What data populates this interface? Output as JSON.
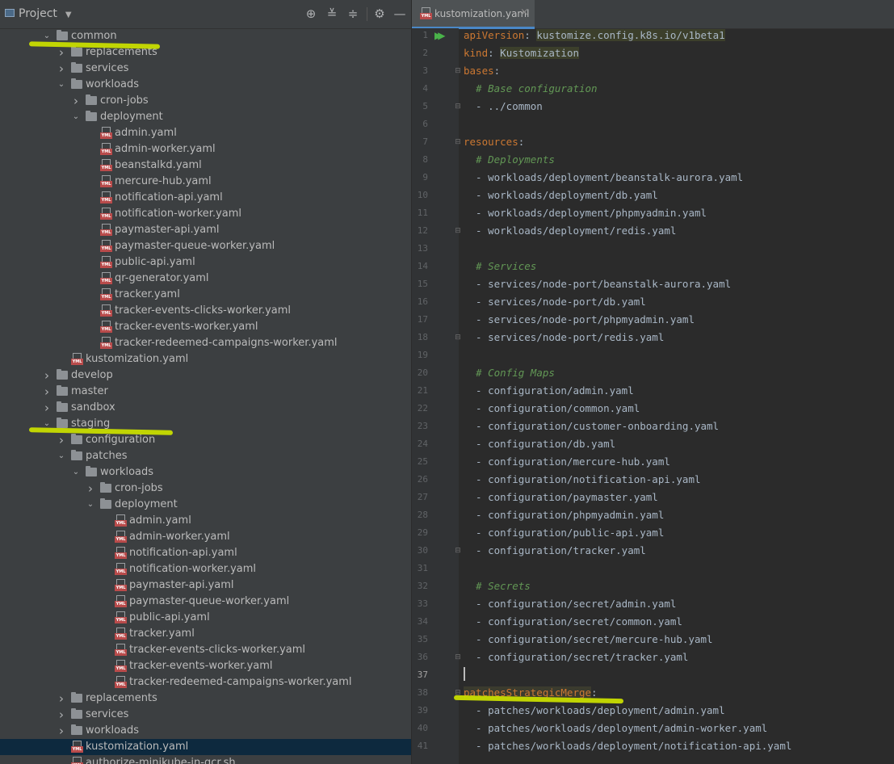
{
  "project_panel": {
    "title": "Project",
    "toolbar_icons": [
      "locate-icon",
      "expand-all-icon",
      "collapse-all-icon",
      "gear-icon",
      "minimize-icon"
    ],
    "tree": [
      {
        "label": "common",
        "type": "folder",
        "depth": 0,
        "expanded": true
      },
      {
        "label": "replacements",
        "type": "folder",
        "depth": 1,
        "expanded": false
      },
      {
        "label": "services",
        "type": "folder",
        "depth": 1,
        "expanded": false
      },
      {
        "label": "workloads",
        "type": "folder",
        "depth": 1,
        "expanded": true
      },
      {
        "label": "cron-jobs",
        "type": "folder",
        "depth": 2,
        "expanded": false
      },
      {
        "label": "deployment",
        "type": "folder",
        "depth": 2,
        "expanded": true
      },
      {
        "label": "admin.yaml",
        "type": "file",
        "depth": 3
      },
      {
        "label": "admin-worker.yaml",
        "type": "file",
        "depth": 3
      },
      {
        "label": "beanstalkd.yaml",
        "type": "file",
        "depth": 3
      },
      {
        "label": "mercure-hub.yaml",
        "type": "file",
        "depth": 3
      },
      {
        "label": "notification-api.yaml",
        "type": "file",
        "depth": 3
      },
      {
        "label": "notification-worker.yaml",
        "type": "file",
        "depth": 3
      },
      {
        "label": "paymaster-api.yaml",
        "type": "file",
        "depth": 3
      },
      {
        "label": "paymaster-queue-worker.yaml",
        "type": "file",
        "depth": 3
      },
      {
        "label": "public-api.yaml",
        "type": "file",
        "depth": 3
      },
      {
        "label": "qr-generator.yaml",
        "type": "file",
        "depth": 3
      },
      {
        "label": "tracker.yaml",
        "type": "file",
        "depth": 3
      },
      {
        "label": "tracker-events-clicks-worker.yaml",
        "type": "file",
        "depth": 3
      },
      {
        "label": "tracker-events-worker.yaml",
        "type": "file",
        "depth": 3
      },
      {
        "label": "tracker-redeemed-campaigns-worker.yaml",
        "type": "file",
        "depth": 3
      },
      {
        "label": "kustomization.yaml",
        "type": "file",
        "depth": 1
      },
      {
        "label": "develop",
        "type": "folder",
        "depth": 0,
        "expanded": false
      },
      {
        "label": "master",
        "type": "folder",
        "depth": 0,
        "expanded": false
      },
      {
        "label": "sandbox",
        "type": "folder",
        "depth": 0,
        "expanded": false
      },
      {
        "label": "staging",
        "type": "folder",
        "depth": 0,
        "expanded": true
      },
      {
        "label": "configuration",
        "type": "folder",
        "depth": 1,
        "expanded": false
      },
      {
        "label": "patches",
        "type": "folder",
        "depth": 1,
        "expanded": true
      },
      {
        "label": "workloads",
        "type": "folder",
        "depth": 2,
        "expanded": true
      },
      {
        "label": "cron-jobs",
        "type": "folder",
        "depth": 3,
        "expanded": false
      },
      {
        "label": "deployment",
        "type": "folder",
        "depth": 3,
        "expanded": true
      },
      {
        "label": "admin.yaml",
        "type": "file",
        "depth": 4
      },
      {
        "label": "admin-worker.yaml",
        "type": "file",
        "depth": 4
      },
      {
        "label": "notification-api.yaml",
        "type": "file",
        "depth": 4
      },
      {
        "label": "notification-worker.yaml",
        "type": "file",
        "depth": 4
      },
      {
        "label": "paymaster-api.yaml",
        "type": "file",
        "depth": 4
      },
      {
        "label": "paymaster-queue-worker.yaml",
        "type": "file",
        "depth": 4
      },
      {
        "label": "public-api.yaml",
        "type": "file",
        "depth": 4
      },
      {
        "label": "tracker.yaml",
        "type": "file",
        "depth": 4
      },
      {
        "label": "tracker-events-clicks-worker.yaml",
        "type": "file",
        "depth": 4
      },
      {
        "label": "tracker-events-worker.yaml",
        "type": "file",
        "depth": 4
      },
      {
        "label": "tracker-redeemed-campaigns-worker.yaml",
        "type": "file",
        "depth": 4
      },
      {
        "label": "replacements",
        "type": "folder",
        "depth": 1,
        "expanded": false
      },
      {
        "label": "services",
        "type": "folder",
        "depth": 1,
        "expanded": false
      },
      {
        "label": "workloads",
        "type": "folder",
        "depth": 1,
        "expanded": false
      },
      {
        "label": "kustomization.yaml",
        "type": "file",
        "depth": 1,
        "selected": true
      },
      {
        "label": "authorize-minikube-in-gcr.sh",
        "type": "file",
        "depth": 1
      }
    ]
  },
  "editor": {
    "tab_label": "kustomization.yaml",
    "lines": [
      {
        "n": "1",
        "t": [
          [
            "k",
            "apiVersion"
          ],
          [
            "p",
            ": "
          ],
          [
            "v",
            "kustomize.config.k8s.io/v1beta1"
          ]
        ]
      },
      {
        "n": "2",
        "t": [
          [
            "k",
            "kind"
          ],
          [
            "p",
            ": "
          ],
          [
            "v",
            "Kustomization"
          ]
        ]
      },
      {
        "n": "3",
        "t": [
          [
            "k",
            "bases"
          ],
          [
            "p",
            ":"
          ]
        ]
      },
      {
        "n": "4",
        "t": [
          [
            "p",
            "  "
          ],
          [
            "c",
            "# Base configuration"
          ]
        ]
      },
      {
        "n": "5",
        "t": [
          [
            "p",
            "  - ../common"
          ]
        ]
      },
      {
        "n": "6",
        "t": []
      },
      {
        "n": "7",
        "t": [
          [
            "k",
            "resources"
          ],
          [
            "p",
            ":"
          ]
        ]
      },
      {
        "n": "8",
        "t": [
          [
            "p",
            "  "
          ],
          [
            "c",
            "# Deployments"
          ]
        ]
      },
      {
        "n": "9",
        "t": [
          [
            "p",
            "  - workloads/deployment/beanstalk-aurora.yaml"
          ]
        ]
      },
      {
        "n": "10",
        "t": [
          [
            "p",
            "  - workloads/deployment/db.yaml"
          ]
        ]
      },
      {
        "n": "11",
        "t": [
          [
            "p",
            "  - workloads/deployment/phpmyadmin.yaml"
          ]
        ]
      },
      {
        "n": "12",
        "t": [
          [
            "p",
            "  - workloads/deployment/redis.yaml"
          ]
        ]
      },
      {
        "n": "13",
        "t": []
      },
      {
        "n": "14",
        "t": [
          [
            "p",
            "  "
          ],
          [
            "c",
            "# Services"
          ]
        ]
      },
      {
        "n": "15",
        "t": [
          [
            "p",
            "  - services/node-port/beanstalk-aurora.yaml"
          ]
        ]
      },
      {
        "n": "16",
        "t": [
          [
            "p",
            "  - services/node-port/db.yaml"
          ]
        ]
      },
      {
        "n": "17",
        "t": [
          [
            "p",
            "  - services/node-port/phpmyadmin.yaml"
          ]
        ]
      },
      {
        "n": "18",
        "t": [
          [
            "p",
            "  - services/node-port/redis.yaml"
          ]
        ]
      },
      {
        "n": "19",
        "t": []
      },
      {
        "n": "20",
        "t": [
          [
            "p",
            "  "
          ],
          [
            "c",
            "# Config Maps"
          ]
        ]
      },
      {
        "n": "21",
        "t": [
          [
            "p",
            "  - configuration/admin.yaml"
          ]
        ]
      },
      {
        "n": "22",
        "t": [
          [
            "p",
            "  - configuration/common.yaml"
          ]
        ]
      },
      {
        "n": "23",
        "t": [
          [
            "p",
            "  - configuration/customer-onboarding.yaml"
          ]
        ]
      },
      {
        "n": "24",
        "t": [
          [
            "p",
            "  - configuration/db.yaml"
          ]
        ]
      },
      {
        "n": "25",
        "t": [
          [
            "p",
            "  - configuration/mercure-hub.yaml"
          ]
        ]
      },
      {
        "n": "26",
        "t": [
          [
            "p",
            "  - configuration/notification-api.yaml"
          ]
        ]
      },
      {
        "n": "27",
        "t": [
          [
            "p",
            "  - configuration/paymaster.yaml"
          ]
        ]
      },
      {
        "n": "28",
        "t": [
          [
            "p",
            "  - configuration/phpmyadmin.yaml"
          ]
        ]
      },
      {
        "n": "29",
        "t": [
          [
            "p",
            "  - configuration/public-api.yaml"
          ]
        ]
      },
      {
        "n": "30",
        "t": [
          [
            "p",
            "  - configuration/tracker.yaml"
          ]
        ]
      },
      {
        "n": "31",
        "t": []
      },
      {
        "n": "32",
        "t": [
          [
            "p",
            "  "
          ],
          [
            "c",
            "# Secrets"
          ]
        ]
      },
      {
        "n": "33",
        "t": [
          [
            "p",
            "  - configuration/secret/admin.yaml"
          ]
        ]
      },
      {
        "n": "34",
        "t": [
          [
            "p",
            "  - configuration/secret/common.yaml"
          ]
        ]
      },
      {
        "n": "35",
        "t": [
          [
            "p",
            "  - configuration/secret/mercure-hub.yaml"
          ]
        ]
      },
      {
        "n": "36",
        "t": [
          [
            "p",
            "  - configuration/secret/tracker.yaml"
          ]
        ]
      },
      {
        "n": "37",
        "t": []
      },
      {
        "n": "38",
        "t": [
          [
            "kb",
            "patchesStrategicMerge"
          ],
          [
            "p",
            ":"
          ]
        ]
      },
      {
        "n": "39",
        "t": [
          [
            "p",
            "  - patches/workloads/deployment/admin.yaml"
          ]
        ]
      },
      {
        "n": "40",
        "t": [
          [
            "p",
            "  - patches/workloads/deployment/admin-worker.yaml"
          ]
        ]
      },
      {
        "n": "41",
        "t": [
          [
            "p",
            "  - patches/workloads/deployment/notification-api.yaml"
          ]
        ]
      }
    ],
    "fold_marker_lines": [
      3,
      5,
      7,
      12,
      18,
      30,
      36,
      38
    ],
    "current_line": "37"
  },
  "colors": {
    "panel_bg": "#3c3f41",
    "editor_bg": "#2b2b2b",
    "key": "#cc7832",
    "comment": "#629755",
    "text": "#a9b7c6",
    "highlighter": "#c8dd00",
    "selection": "#0d293e"
  }
}
